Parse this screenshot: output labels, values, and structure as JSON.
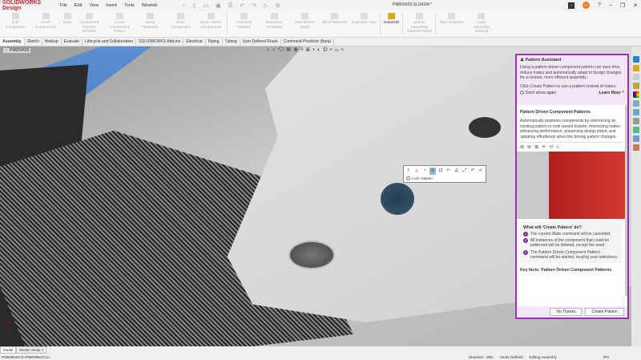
{
  "app": {
    "logo": "SOLIDWORKS Design",
    "document_title": "PM009629.SLDASM *"
  },
  "menu": [
    "File",
    "Edit",
    "View",
    "Insert",
    "Tools",
    "Window"
  ],
  "ribbon": [
    {
      "label": "Edit Component",
      "active": false
    },
    {
      "label": "Insert Components",
      "active": false
    },
    {
      "label": "Mate",
      "active": false
    },
    {
      "label": "Component Preview Window",
      "active": false
    },
    {
      "label": "Linear Component Pattern",
      "active": false
    },
    {
      "label": "Smart Fasteners",
      "active": false
    },
    {
      "label": "Move Component",
      "active": false
    },
    {
      "label": "Show Hidden Components",
      "active": false
    },
    {
      "label": "Assembly Features",
      "active": false
    },
    {
      "label": "Reference Geometry",
      "active": false
    },
    {
      "label": "New Motion Study",
      "active": false
    },
    {
      "label": "Bill of Materials",
      "active": false
    },
    {
      "label": "Exploded View",
      "active": false
    },
    {
      "label": "Instant3D",
      "active": true
    },
    {
      "label": "Update SpeedPak Subassemblies",
      "active": false
    },
    {
      "label": "Take Snapshot",
      "active": false
    },
    {
      "label": "Large Assembly Settings",
      "active": false
    }
  ],
  "tabs": [
    "Assembly",
    "Sketch",
    "Markup",
    "Evaluate",
    "Lifecycle and Collaboration",
    "SOLIDWORKS Add-Ins",
    "Electrical",
    "Piping",
    "Tubing",
    "User Defined Route",
    "Command Predictor (Beta)"
  ],
  "user_initials": "CT",
  "tree_root": "PM009629",
  "mate_popup": {
    "lock_rotation": "Lock rotation"
  },
  "pattern_assistant": {
    "title": "Pattern Assistant",
    "intro": "Using a pattern driven component pattern can save time, reduce mates and automatically adapt to design changes for a cleaner, more efficient assembly.",
    "hint": "Click Create Pattern to use a pattern instead of mates.",
    "dont_show": "Don't show again",
    "learn_more": "Learn More ^",
    "section_title": "Pattern Driven Component Patterns",
    "section_text": "Automatically positions components by referencing an existing pattern or hole wizard feature, minimizing mates enhancing performance, preserving design intent, and updating effortlessly when the driving pattern changes.",
    "what_title": "What will 'Create Pattern' do?",
    "steps": [
      "The current Mate command will be cancelled.",
      "All instances of the component that could be patterned will be deleted, except the seed.",
      "The Pattern Driven Component Pattern command will be started, reusing your selections."
    ],
    "key_facts": "Key facts: Pattern Driven Component Patterns",
    "no_thanks": "No Thanks",
    "create": "Create Pattern"
  },
  "bottom_tabs": [
    "Model",
    "Motion Study 1"
  ],
  "status": {
    "path": "PM009646<1>/PM009647<1>",
    "diameter": "Diameter: .39in",
    "defined": "Under Defined",
    "mode": "Editing Assembly",
    "units": "IPS"
  },
  "colors": {
    "accent": "#9b30b5",
    "brand": "#d0282e",
    "step": "#7b2c91"
  }
}
